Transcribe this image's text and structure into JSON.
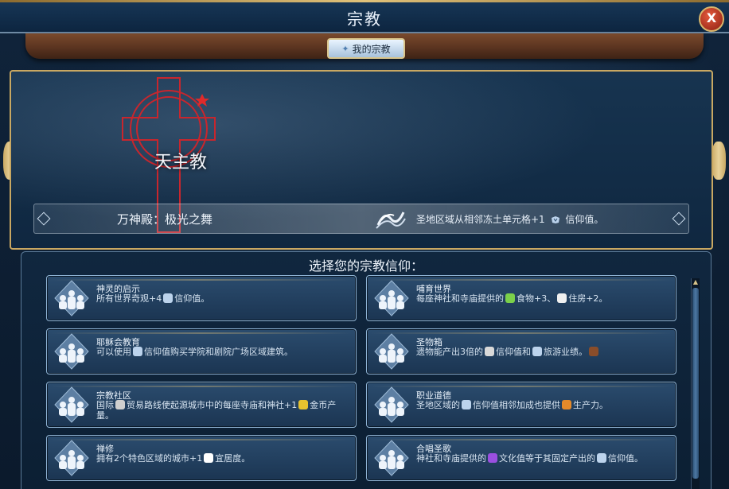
{
  "window": {
    "title": "宗教",
    "close_label": "X"
  },
  "tabs": [
    {
      "label": "我的宗教",
      "icon": "religion-star-icon"
    }
  ],
  "religion": {
    "name": "天主教",
    "icon": "celtic-cross-icon",
    "color": "#c8262d"
  },
  "pantheon": {
    "name": "万神殿：极光之舞",
    "icon": "aurora-icon",
    "description_prefix": "圣地区域从相邻冻土单元格+1",
    "description_suffix": "信仰值。"
  },
  "beliefs_prompt": "选择您的宗教信仰：",
  "beliefs": [
    {
      "name": "神灵的启示",
      "desc_1": "所有世界奇观+4",
      "desc_2": "信仰值。",
      "icon_a": "faith-icon"
    },
    {
      "name": "哺育世界",
      "desc_1": "每座神社和寺庙提供的",
      "desc_2": "食物+3、",
      "desc_3": "住房+2。",
      "icon_a": "food-icon",
      "icon_b": "housing-icon"
    },
    {
      "name": "耶稣会教育",
      "desc_1": "可以使用",
      "desc_2": "信仰值购买学院和剧院广场区域建筑。",
      "icon_a": "faith-icon"
    },
    {
      "name": "圣物箱",
      "desc_1": "遗物能产出3倍的",
      "desc_2": "信仰值和",
      "desc_3": "旅游业绩。",
      "icon_a": "relic-icon",
      "icon_b": "faith-icon",
      "icon_c": "tourism-icon"
    },
    {
      "name": "宗教社区",
      "desc_1": "国际",
      "desc_2": "贸易路线使起源城市中的每座寺庙和神社+1",
      "desc_3": "金币产量。",
      "icon_a": "trade-route-icon",
      "icon_b": "gold-icon"
    },
    {
      "name": "职业道德",
      "desc_1": "圣地区域的",
      "desc_2": "信仰值相邻加成也提供",
      "desc_3": "生产力。",
      "icon_a": "faith-icon",
      "icon_b": "production-icon"
    },
    {
      "name": "禅修",
      "desc_1": "拥有2个特色区域的城市+1",
      "desc_2": "宜居度。",
      "icon_a": "amenities-icon"
    },
    {
      "name": "合唱圣歌",
      "desc_1": "神社和寺庙提供的",
      "desc_2": "文化值等于其固定产出的",
      "desc_3": "信仰值。",
      "icon_a": "culture-icon",
      "icon_b": "faith-icon"
    }
  ],
  "colors": {
    "gold_trim": "#c9a862",
    "card_bg": "#2b4c6e",
    "accent_red": "#c8262d"
  }
}
